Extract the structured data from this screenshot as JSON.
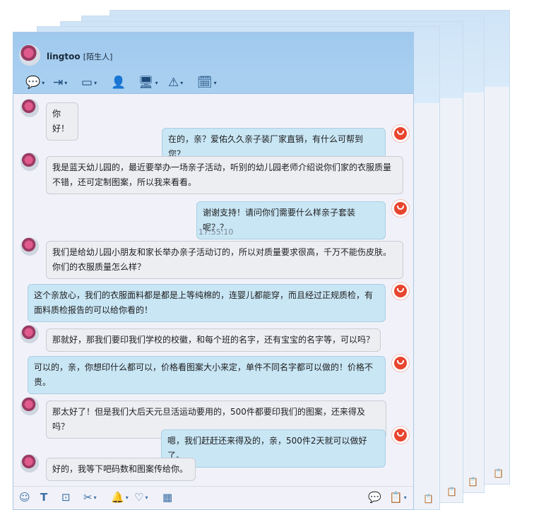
{
  "contact": {
    "name": "lingtoo",
    "tag": "[陌生人]"
  },
  "toolbar": [
    {
      "icon": "chat-bubble-icon",
      "glyph": "💬"
    },
    {
      "icon": "file-transfer-icon",
      "glyph": "⇥"
    },
    {
      "icon": "video-call-icon",
      "glyph": "▭"
    },
    {
      "icon": "add-contact-icon",
      "glyph": "👤"
    },
    {
      "icon": "screen-share-icon",
      "glyph": "🖥"
    },
    {
      "icon": "remote-assist-icon",
      "glyph": "⚠"
    },
    {
      "icon": "calendar-icon",
      "glyph": "🗓"
    }
  ],
  "messages": [
    {
      "side": "in",
      "lines": [
        "你好！"
      ]
    },
    {
      "side": "out",
      "lines": [
        "在的，亲？爱佑久久亲子装厂家直销，有什么可帮到您？"
      ]
    },
    {
      "side": "in",
      "lines": [
        "我是蓝天幼儿园的，最近要举办一场亲子活动，听别的幼儿园老师介绍说你们家的衣服质量",
        "不错，还可定制图案，所以我来看看。"
      ]
    },
    {
      "side": "out",
      "lines": [
        "谢谢支持！请问你们需要什么样亲子套装呢？？"
      ]
    },
    {
      "side": "in",
      "lines": [
        "我们是给幼儿园小朋友和家长举办亲子活动订的，所以对质量要求很高，千万不能伤皮肤。",
        "你们的衣服质量怎么样？"
      ]
    },
    {
      "side": "out",
      "lines": [
        "这个亲放心，我们的衣服面料都是都是上等纯棉的，连婴儿都能穿，而且经过正规质检，有",
        "面料质检报告的可以给你看的！"
      ]
    },
    {
      "side": "in",
      "lines": [
        "那就好，那我们要印我们学校的校徽，和每个班的名字，还有宝宝的名字等，可以吗？"
      ]
    },
    {
      "side": "out",
      "lines": [
        "可以的，亲，你想印什么都可以，价格看图案大小来定，单件不同名字都可以做的！价格不",
        "贵。"
      ]
    },
    {
      "side": "in",
      "lines": [
        "那太好了！但是我们大后天元旦活运动要用的，500件都要印我们的图案，还来得及吗？"
      ]
    },
    {
      "side": "out",
      "lines": [
        "嗯，我们赶赶还来得及的，亲，500件2天就可以做好了。"
      ]
    },
    {
      "side": "in",
      "lines": [
        "好的，我等下吧码数和图案传给你。"
      ]
    }
  ],
  "timestamp": "17:55:10",
  "input_toolbar": [
    {
      "icon": "emoji-icon",
      "glyph": "☺"
    },
    {
      "icon": "font-icon",
      "glyph": "T"
    },
    {
      "icon": "magic-emoji-icon",
      "glyph": "⊡"
    },
    {
      "icon": "screenshot-scissors-icon",
      "glyph": "✂"
    },
    {
      "icon": "bell-icon",
      "glyph": "🔔"
    },
    {
      "icon": "heart-icon",
      "glyph": "♡"
    },
    {
      "icon": "image-icon",
      "glyph": "▦"
    }
  ],
  "input_right_icons": [
    {
      "icon": "chat-history-icon",
      "glyph": "💬"
    },
    {
      "icon": "message-log-icon",
      "glyph": "📋"
    }
  ],
  "stack_doc_icon": "📋"
}
